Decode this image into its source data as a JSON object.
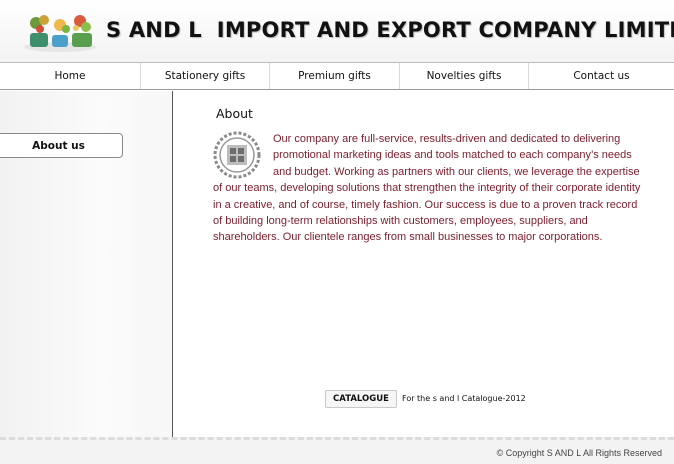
{
  "header": {
    "title": "S AND L  IMPORT AND EXPORT COMPANY LIMITED",
    "logo_icon": "flower-pots-logo"
  },
  "nav": {
    "items": [
      {
        "label": "Home"
      },
      {
        "label": "Stationery gifts"
      },
      {
        "label": "Premium gifts"
      },
      {
        "label": "Novelties gifts"
      },
      {
        "label": "Contact us"
      }
    ]
  },
  "sidebar": {
    "about_button": "About  us"
  },
  "main": {
    "section_title": "About",
    "seal_icon": "chinese-seal-emblem",
    "body_text": "Our company are full-service, results-driven and dedicated to delivering promotional marketing ideas and tools matched to each company’s needs and budget. Working as partners with our clients, we leverage the expertise of our teams, developing solutions that strengthen the integrity of their corporate identity in a creative, and of course, timely fashion. Our success is due to a proven track record of building long-term relationships with customers, employees, suppliers, and shareholders. Our clientele ranges from small businesses to major corporations.",
    "text_color": "#7a1e2c",
    "catalogue_button": "CATALOGUE",
    "catalogue_caption": "For the s and l Catalogue-2012"
  },
  "footer": {
    "copyright": "© Copyright S AND L All Rights Reserved"
  }
}
